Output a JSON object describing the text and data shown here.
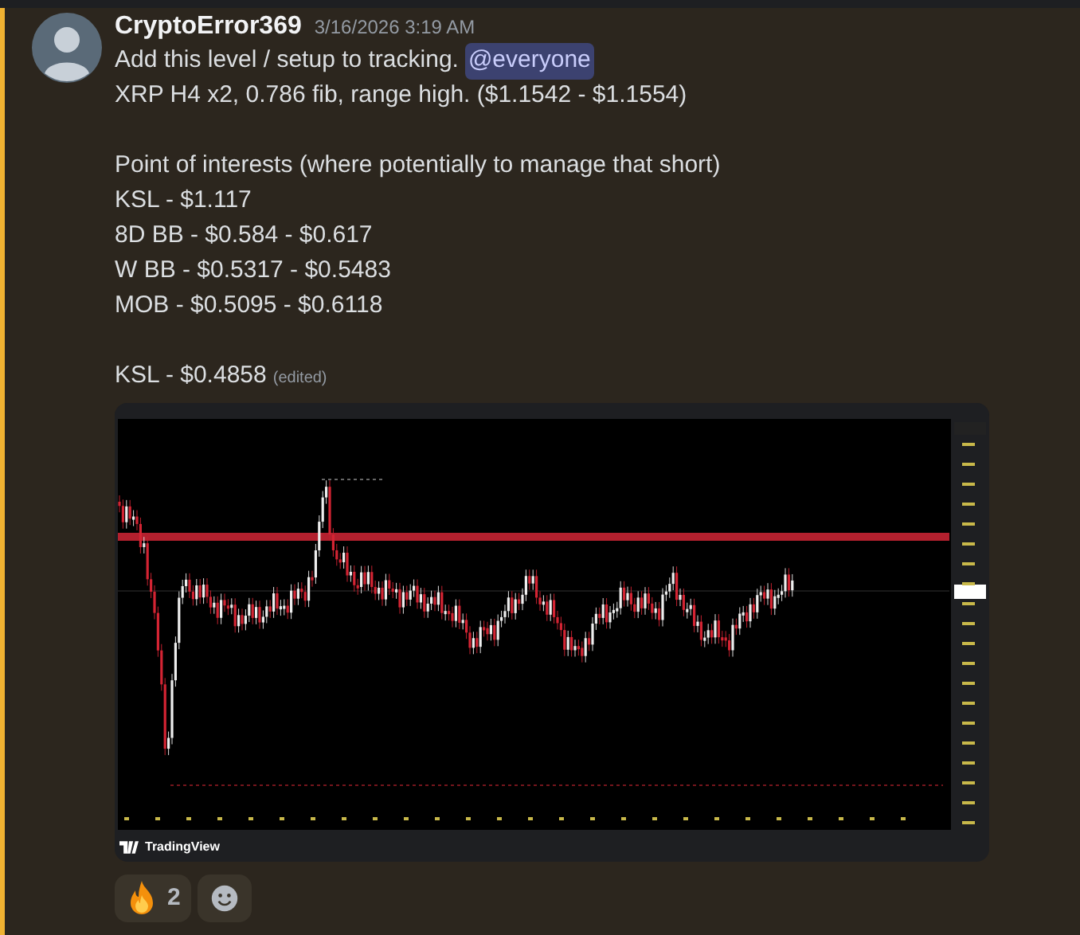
{
  "message": {
    "author": "CryptoError369",
    "timestamp": "3/16/2026 3:19 AM",
    "mentioned": true,
    "paragraphs": [
      [
        {
          "text": "Add this level / setup to tracking.",
          "mention": "@everyone"
        },
        {
          "text": "XRP H4 x2, 0.786 fib, range high. ($1.1542 - $1.1554)"
        }
      ],
      [
        {
          "text": "Point of interests (where potentially to manage that short)"
        },
        {
          "text": "KSL - $1.117"
        },
        {
          "text": "8D BB - $0.584 - $0.617"
        },
        {
          "text": "W BB - $0.5317 - $0.5483"
        },
        {
          "text": "MOB - $0.5095 - $0.6118"
        }
      ],
      [
        {
          "text": "KSL - $0.4858"
        }
      ]
    ],
    "edited": "(edited)",
    "attachment": {
      "kind": "picture",
      "source": "TradingView"
    },
    "reactions": [
      {
        "count": "2",
        "selected": false
      }
    ]
  }
}
